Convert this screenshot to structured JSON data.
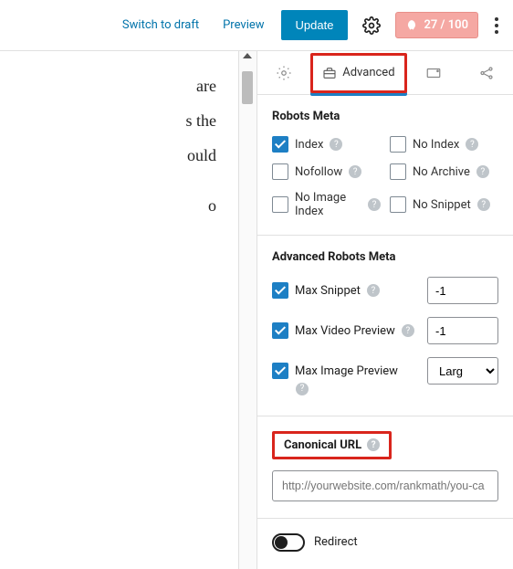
{
  "topbar": {
    "switch_to_draft": "Switch to draft",
    "preview": "Preview",
    "update": "Update",
    "score": "27 / 100"
  },
  "editor": {
    "lines": [
      "are",
      "s the",
      "ould",
      "o"
    ]
  },
  "tabs": {
    "advanced_label": "Advanced"
  },
  "robots_meta": {
    "title": "Robots Meta",
    "items": [
      {
        "label": "Index",
        "checked": true
      },
      {
        "label": "No Index",
        "checked": false
      },
      {
        "label": "Nofollow",
        "checked": false
      },
      {
        "label": "No Archive",
        "checked": false
      },
      {
        "label": "No Image Index",
        "checked": false
      },
      {
        "label": "No Snippet",
        "checked": false
      }
    ]
  },
  "advanced_robots": {
    "title": "Advanced Robots Meta",
    "max_snippet_label": "Max Snippet",
    "max_snippet_value": "-1",
    "max_video_label": "Max Video Preview",
    "max_video_value": "-1",
    "max_image_label": "Max Image Preview",
    "max_image_value": "Large"
  },
  "canonical": {
    "title": "Canonical URL",
    "placeholder": "http://yourwebsite.com/rankmath/you-ca"
  },
  "redirect": {
    "label": "Redirect"
  }
}
